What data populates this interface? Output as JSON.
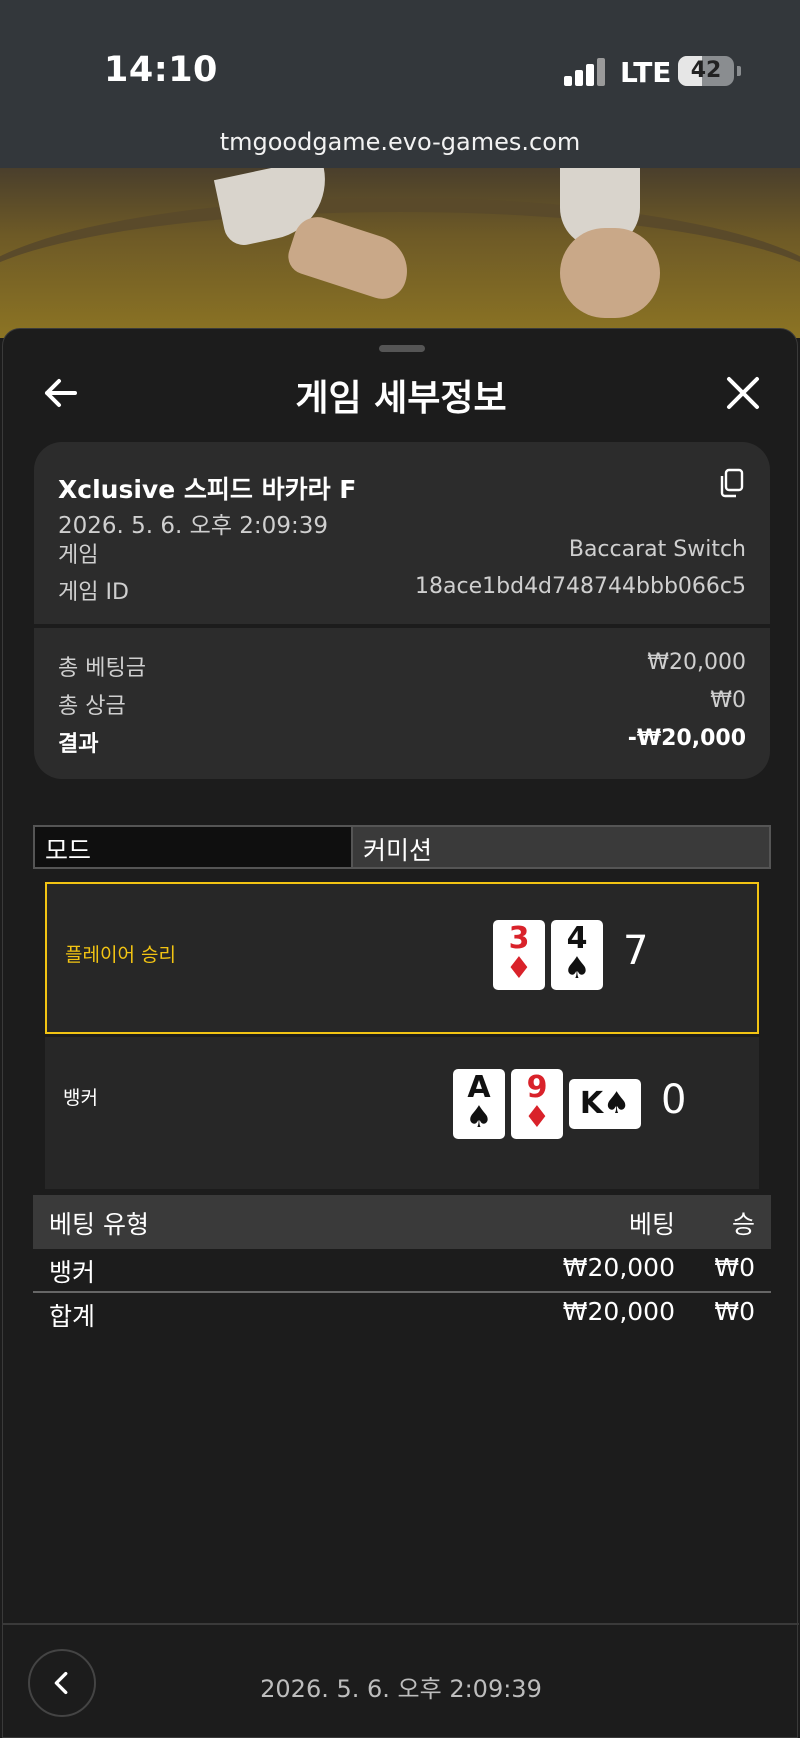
{
  "status": {
    "time": "14:10",
    "network": "LTE",
    "battery": "42",
    "battery_level": 0.42
  },
  "browser": {
    "url": "tmgoodgame.evo-games.com"
  },
  "sheet": {
    "title": "게임 세부정보",
    "back_icon": "arrow-left-icon",
    "close_icon": "close-icon"
  },
  "summary": {
    "game_name": "Xclusive 스피드 바카라 F",
    "datetime": "2026. 5. 6. 오후 2:09:39",
    "game_label": "게임",
    "game_value": "Baccarat Switch",
    "id_label": "게임 ID",
    "id_value": "18ace1bd4d748744bbb066c5",
    "total_bet_label": "총 베팅금",
    "total_bet_value": "₩20,000",
    "total_win_label": "총 상금",
    "total_win_value": "₩0",
    "result_label": "결과",
    "result_value": "-₩20,000"
  },
  "tabs": {
    "mode": "모드",
    "commission": "커미션"
  },
  "player": {
    "label": "플레이어 승리",
    "score": "7",
    "cards": [
      {
        "rank": "3",
        "suit": "♦"
      },
      {
        "rank": "4",
        "suit": "♠"
      }
    ]
  },
  "banker": {
    "label": "뱅커",
    "score": "0",
    "cards": [
      {
        "rank": "A",
        "suit": "♠"
      },
      {
        "rank": "9",
        "suit": "♦"
      },
      {
        "rank": "K",
        "suit": "♠"
      }
    ]
  },
  "bets": {
    "headers": {
      "type": "베팅 유형",
      "bet": "베팅",
      "win": "승"
    },
    "rows": [
      {
        "type": "뱅커",
        "bet": "₩20,000",
        "win": "₩0"
      }
    ],
    "total": {
      "type": "합계",
      "bet": "₩20,000",
      "win": "₩0"
    }
  },
  "footer": {
    "datetime": "2026. 5. 6. 오후 2:09:39"
  },
  "colors": {
    "winner_accent": "#f2c413",
    "red_suit": "#d9222a",
    "background": "#1c1c1c"
  }
}
